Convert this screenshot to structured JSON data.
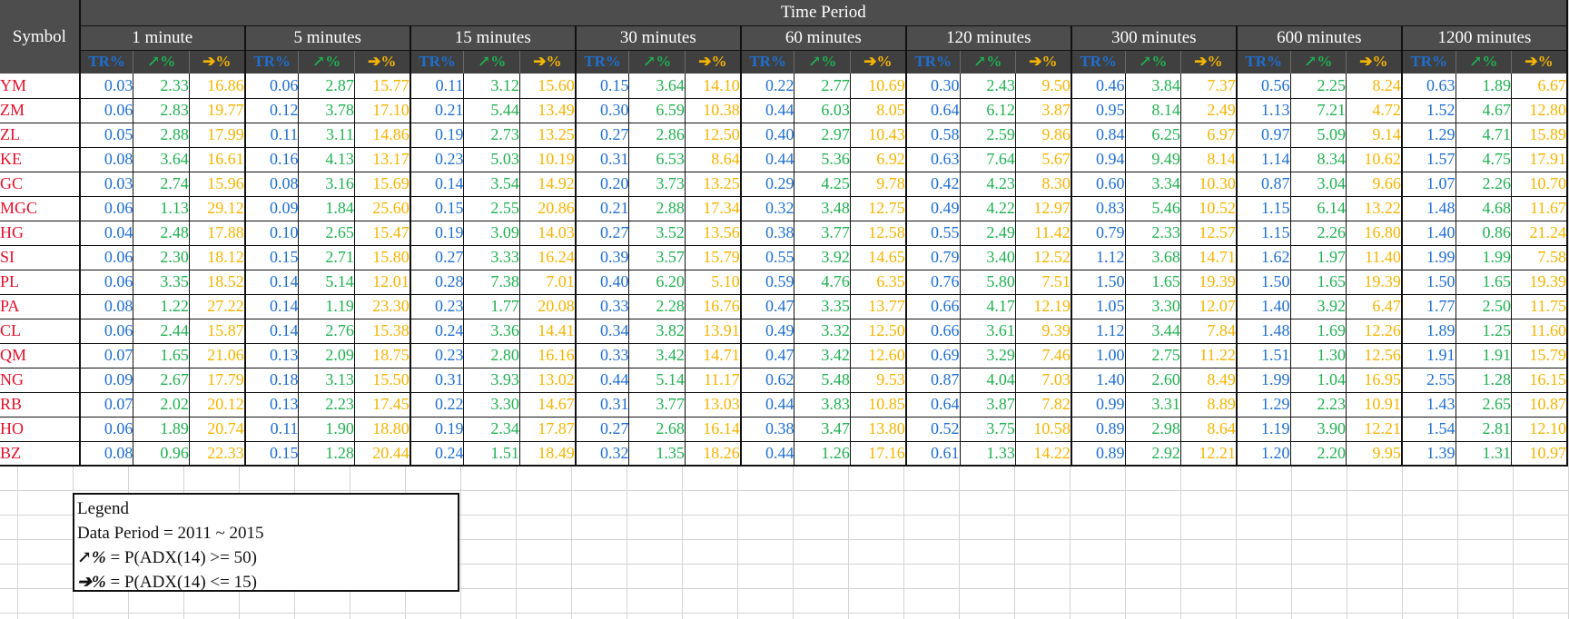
{
  "header": {
    "symbol_label": "Symbol",
    "time_period_label": "Time Period"
  },
  "periods": [
    "1 minute",
    "5  minutes",
    "15  minutes",
    "30  minutes",
    "60  minutes",
    "120  minutes",
    "300  minutes",
    "600  minutes",
    "1200  minutes"
  ],
  "subheaders": {
    "tr": "TR%",
    "up_glyph": "↗",
    "up_suffix": "%",
    "side_glyph": "➔",
    "side_suffix": "%"
  },
  "colors": {
    "header_bg": "#4d4d4d",
    "symbol": "#e0102a",
    "tr": "#1f6fd0",
    "up": "#20b050",
    "side": "#f5b400"
  },
  "rows": [
    {
      "symbol": "YM",
      "values": [
        "0.03",
        "2.33",
        "16.86",
        "0.06",
        "2.87",
        "15.77",
        "0.11",
        "3.12",
        "15.60",
        "0.15",
        "3.64",
        "14.10",
        "0.22",
        "2.77",
        "10.69",
        "0.30",
        "2.43",
        "9.50",
        "0.46",
        "3.84",
        "7.37",
        "0.56",
        "2.25",
        "8.24",
        "0.63",
        "1.89",
        "6.67"
      ]
    },
    {
      "symbol": "ZM",
      "values": [
        "0.06",
        "2.83",
        "19.77",
        "0.12",
        "3.78",
        "17.10",
        "0.21",
        "5.44",
        "13.49",
        "0.30",
        "6.59",
        "10.38",
        "0.44",
        "6.03",
        "8.05",
        "0.64",
        "6.12",
        "3.87",
        "0.95",
        "8.14",
        "2.49",
        "1.13",
        "7.21",
        "4.72",
        "1.52",
        "4.67",
        "12.80"
      ]
    },
    {
      "symbol": "ZL",
      "values": [
        "0.05",
        "2.88",
        "17.99",
        "0.11",
        "3.11",
        "14.86",
        "0.19",
        "2.73",
        "13.25",
        "0.27",
        "2.86",
        "12.50",
        "0.40",
        "2.97",
        "10.43",
        "0.58",
        "2.59",
        "9.86",
        "0.84",
        "6.25",
        "6.97",
        "0.97",
        "5.09",
        "9.14",
        "1.29",
        "4.71",
        "15.89"
      ]
    },
    {
      "symbol": "KE",
      "values": [
        "0.08",
        "3.64",
        "16.61",
        "0.16",
        "4.13",
        "13.17",
        "0.23",
        "5.03",
        "10.19",
        "0.31",
        "6.53",
        "8.64",
        "0.44",
        "5.36",
        "6.92",
        "0.63",
        "7.64",
        "5.67",
        "0.94",
        "9.49",
        "8.14",
        "1.14",
        "8.34",
        "10.62",
        "1.57",
        "4.75",
        "17.91"
      ]
    },
    {
      "symbol": "GC",
      "values": [
        "0.03",
        "2.74",
        "15.96",
        "0.08",
        "3.16",
        "15.69",
        "0.14",
        "3.54",
        "14.92",
        "0.20",
        "3.73",
        "13.25",
        "0.29",
        "4.25",
        "9.78",
        "0.42",
        "4.23",
        "8.30",
        "0.60",
        "3.34",
        "10.30",
        "0.87",
        "3.04",
        "9.66",
        "1.07",
        "2.26",
        "10.70"
      ]
    },
    {
      "symbol": "MGC",
      "values": [
        "0.06",
        "1.13",
        "29.12",
        "0.09",
        "1.84",
        "25.60",
        "0.15",
        "2.55",
        "20.86",
        "0.21",
        "2.88",
        "17.34",
        "0.32",
        "3.48",
        "12.75",
        "0.49",
        "4.22",
        "12.97",
        "0.83",
        "5.46",
        "10.52",
        "1.15",
        "6.14",
        "13.22",
        "1.48",
        "4.68",
        "11.67"
      ]
    },
    {
      "symbol": "HG",
      "values": [
        "0.04",
        "2.48",
        "17.88",
        "0.10",
        "2.65",
        "15.47",
        "0.19",
        "3.09",
        "14.03",
        "0.27",
        "3.52",
        "13.56",
        "0.38",
        "3.77",
        "12.58",
        "0.55",
        "2.49",
        "11.42",
        "0.79",
        "2.33",
        "12.57",
        "1.15",
        "2.26",
        "16.80",
        "1.40",
        "0.86",
        "21.24"
      ]
    },
    {
      "symbol": "SI",
      "values": [
        "0.06",
        "2.30",
        "18.12",
        "0.15",
        "2.71",
        "15.80",
        "0.27",
        "3.33",
        "16.24",
        "0.39",
        "3.57",
        "15.79",
        "0.55",
        "3.92",
        "14.65",
        "0.79",
        "3.40",
        "12.52",
        "1.12",
        "3.68",
        "14.71",
        "1.62",
        "1.97",
        "11.40",
        "1.99",
        "1.99",
        "7.58"
      ]
    },
    {
      "symbol": "PL",
      "values": [
        "0.06",
        "3.35",
        "18.52",
        "0.14",
        "5.14",
        "12.01",
        "0.28",
        "7.38",
        "7.01",
        "0.40",
        "6.20",
        "5.10",
        "0.59",
        "4.76",
        "6.35",
        "0.76",
        "5.80",
        "7.51",
        "1.50",
        "1.65",
        "19.39",
        "1.50",
        "1.65",
        "19.39",
        "1.50",
        "1.65",
        "19.39"
      ]
    },
    {
      "symbol": "PA",
      "values": [
        "0.08",
        "1.22",
        "27.22",
        "0.14",
        "1.19",
        "23.30",
        "0.23",
        "1.77",
        "20.08",
        "0.33",
        "2.28",
        "16.76",
        "0.47",
        "3.35",
        "13.77",
        "0.66",
        "4.17",
        "12.19",
        "1.05",
        "3.30",
        "12.07",
        "1.40",
        "3.92",
        "6.47",
        "1.77",
        "2.50",
        "11.75"
      ]
    },
    {
      "symbol": "CL",
      "values": [
        "0.06",
        "2.44",
        "15.87",
        "0.14",
        "2.76",
        "15.38",
        "0.24",
        "3.36",
        "14.41",
        "0.34",
        "3.82",
        "13.91",
        "0.49",
        "3.32",
        "12.50",
        "0.66",
        "3.61",
        "9.39",
        "1.12",
        "3.44",
        "7.84",
        "1.48",
        "1.69",
        "12.26",
        "1.89",
        "1.25",
        "11.60"
      ]
    },
    {
      "symbol": "QM",
      "values": [
        "0.07",
        "1.65",
        "21.06",
        "0.13",
        "2.09",
        "18.75",
        "0.23",
        "2.80",
        "16.16",
        "0.33",
        "3.42",
        "14.71",
        "0.47",
        "3.42",
        "12.60",
        "0.69",
        "3.29",
        "7.46",
        "1.00",
        "2.75",
        "11.22",
        "1.51",
        "1.30",
        "12.56",
        "1.91",
        "1.91",
        "15.79"
      ]
    },
    {
      "symbol": "NG",
      "values": [
        "0.09",
        "2.67",
        "17.79",
        "0.18",
        "3.13",
        "15.50",
        "0.31",
        "3.93",
        "13.02",
        "0.44",
        "5.14",
        "11.17",
        "0.62",
        "5.48",
        "9.53",
        "0.87",
        "4.04",
        "7.03",
        "1.40",
        "2.60",
        "8.49",
        "1.99",
        "1.04",
        "16.95",
        "2.55",
        "1.28",
        "16.15"
      ]
    },
    {
      "symbol": "RB",
      "values": [
        "0.07",
        "2.02",
        "20.12",
        "0.13",
        "2.23",
        "17.45",
        "0.22",
        "3.30",
        "14.67",
        "0.31",
        "3.77",
        "13.03",
        "0.44",
        "3.83",
        "10.85",
        "0.64",
        "3.87",
        "7.82",
        "0.99",
        "3.31",
        "8.89",
        "1.29",
        "2.23",
        "10.91",
        "1.43",
        "2.65",
        "10.87"
      ]
    },
    {
      "symbol": "HO",
      "values": [
        "0.06",
        "1.89",
        "20.74",
        "0.11",
        "1.90",
        "18.80",
        "0.19",
        "2.34",
        "17.87",
        "0.27",
        "2.68",
        "16.14",
        "0.38",
        "3.47",
        "13.80",
        "0.52",
        "3.75",
        "10.58",
        "0.89",
        "2.98",
        "8.64",
        "1.19",
        "3.90",
        "12.21",
        "1.54",
        "2.81",
        "12.10"
      ]
    },
    {
      "symbol": "BZ",
      "values": [
        "0.08",
        "0.96",
        "22.33",
        "0.15",
        "1.28",
        "20.44",
        "0.24",
        "1.51",
        "18.49",
        "0.32",
        "1.35",
        "18.26",
        "0.44",
        "1.26",
        "17.16",
        "0.61",
        "1.33",
        "14.22",
        "0.89",
        "2.92",
        "12.21",
        "1.20",
        "2.20",
        "9.95",
        "1.39",
        "1.31",
        "10.97"
      ]
    }
  ],
  "legend": {
    "title": "Legend",
    "data_period": "Data Period = 2011 ~ 2015",
    "up_glyph": "↗%",
    "up_text": " = P(ADX(14) >= 50)",
    "side_glyph": "➔%",
    "side_text": " = P(ADX(14) <= 15)"
  }
}
